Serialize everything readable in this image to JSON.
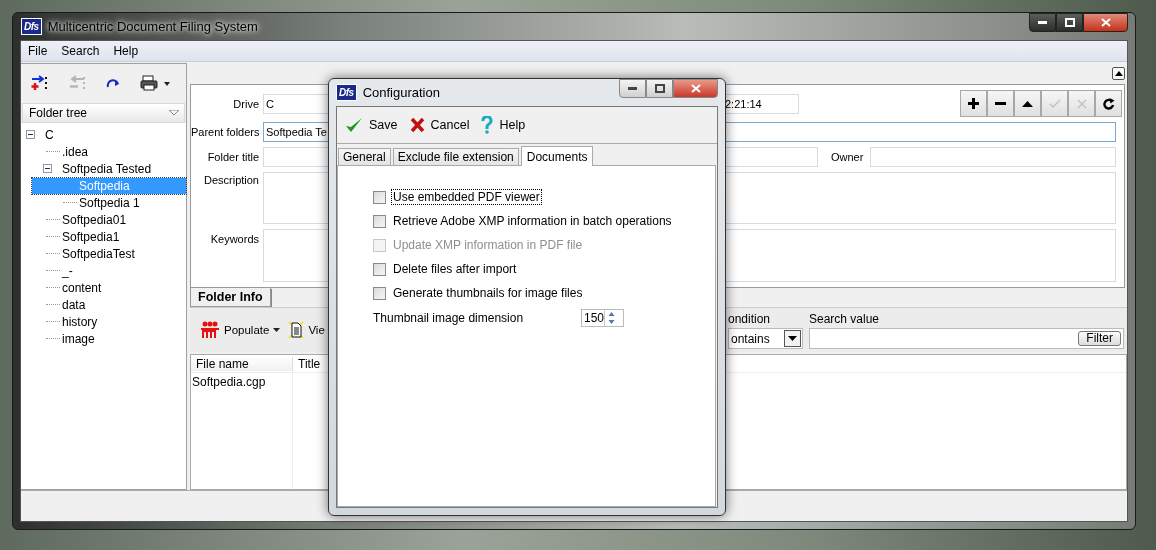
{
  "window": {
    "logo": "Dfs",
    "title": "Multicentric Document Filing System"
  },
  "menu": [
    "File",
    "Search",
    "Help"
  ],
  "toolbar": [
    {
      "kind": "add",
      "disabled": false
    },
    {
      "kind": "remove",
      "disabled": true
    },
    {
      "kind": "refresh",
      "disabled": false
    },
    {
      "kind": "print",
      "disabled": false
    }
  ],
  "folder_tree": {
    "header": "Folder tree",
    "items": [
      {
        "label": "C",
        "expanded": true,
        "selected": false,
        "children": [
          {
            "label": ".idea",
            "selected": false
          },
          {
            "label": "Softpedia Tested",
            "expanded": true,
            "selected": false,
            "children": [
              {
                "label": "Softpedia",
                "selected": true
              },
              {
                "label": "Softpedia 1",
                "selected": false
              }
            ]
          },
          {
            "label": "Softpedia01",
            "selected": false
          },
          {
            "label": "Softpedia1",
            "selected": false
          },
          {
            "label": "SoftpediaTest",
            "selected": false
          },
          {
            "label": "_-",
            "selected": false
          },
          {
            "label": "content",
            "selected": false
          },
          {
            "label": "data",
            "selected": false
          },
          {
            "label": "history",
            "selected": false
          },
          {
            "label": "image",
            "selected": false
          }
        ]
      }
    ]
  },
  "form": {
    "drive": {
      "label": "Drive",
      "value": "C"
    },
    "time_value": "2:21:14",
    "parent_folders": {
      "label": "Parent folders",
      "value": "Softpedia Te"
    },
    "folder_title": {
      "label": "Folder title"
    },
    "owner": {
      "label": "Owner"
    },
    "description": {
      "label": "Description"
    },
    "keywords": {
      "label": "Keywords"
    }
  },
  "record_buttons": [
    {
      "kind": "add",
      "disabled": false
    },
    {
      "kind": "remove",
      "disabled": false
    },
    {
      "kind": "up",
      "disabled": false
    },
    {
      "kind": "confirm",
      "disabled": true
    },
    {
      "kind": "cancel",
      "disabled": true
    },
    {
      "kind": "refresh",
      "disabled": false
    }
  ],
  "tabs": [
    {
      "label": "Folder Info",
      "selected": true
    }
  ],
  "files_toolbar": {
    "populate": "Populate",
    "view": "Vie",
    "condition_label": "ondition",
    "condition_value": "ontains",
    "search_label": "Search value",
    "filter": "Filter"
  },
  "file_list": {
    "columns": [
      "File name",
      "Title"
    ],
    "rows": [
      [
        "Softpedia.cgp"
      ]
    ]
  },
  "dialog": {
    "logo": "Dfs",
    "title": "Configuration",
    "actions": [
      {
        "kind": "save",
        "label": "Save"
      },
      {
        "kind": "cancel",
        "label": "Cancel"
      },
      {
        "kind": "help",
        "label": "Help"
      }
    ],
    "tabs": [
      {
        "label": "General",
        "selected": false
      },
      {
        "label": "Exclude file extension",
        "selected": false
      },
      {
        "label": "Documents",
        "selected": true
      }
    ],
    "options": [
      {
        "label": "Use embedded PDF viewer",
        "checked": false,
        "disabled": false,
        "focused": true
      },
      {
        "label": "Retrieve Adobe XMP information in batch operations",
        "checked": false,
        "disabled": false,
        "focused": false
      },
      {
        "label": "Update XMP information in PDF file",
        "checked": false,
        "disabled": true,
        "focused": false
      },
      {
        "label": "Delete files after import",
        "checked": false,
        "disabled": false,
        "focused": false
      },
      {
        "label": "Generate thumbnails for image files",
        "checked": false,
        "disabled": false,
        "focused": false
      }
    ],
    "dimension": {
      "label": "Thumbnail image dimension",
      "value": "150"
    }
  }
}
